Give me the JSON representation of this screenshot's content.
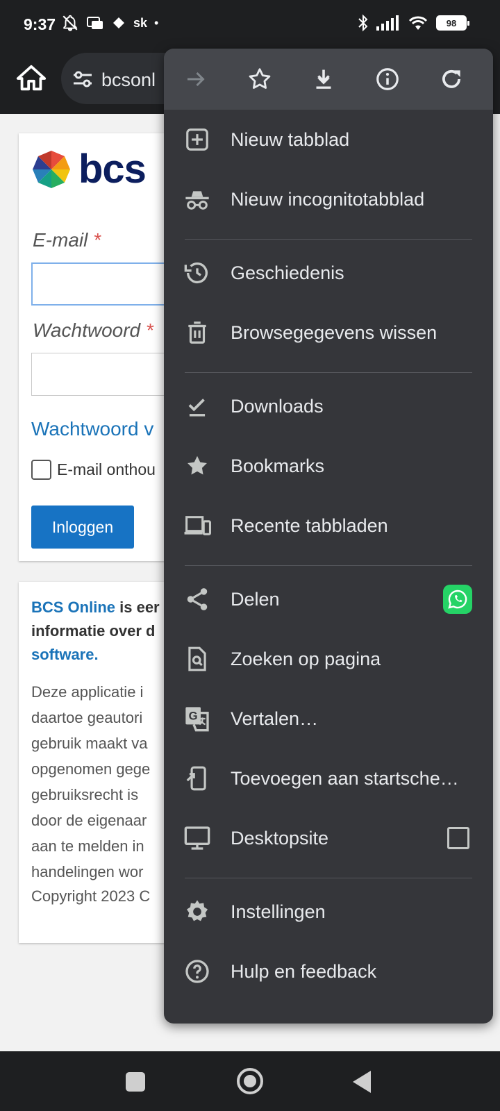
{
  "status": {
    "time": "9:37",
    "sk": "sk",
    "dot": "•",
    "battery": "98"
  },
  "toolbar": {
    "url": "bcsonl"
  },
  "page": {
    "logo_text": "bcs",
    "email_label": "E-mail",
    "password_label": "Wachtwoord",
    "required_mark": "*",
    "forgot_link": "Wachtwoord v",
    "remember_label": "E-mail onthou",
    "login_button": "Inloggen",
    "intro_link": "BCS Online",
    "intro_text": " is eer",
    "intro_line2": "informatie over d",
    "intro_link2": "software.",
    "body_lines": [
      "Deze applicatie i",
      "daartoe geautori",
      "gebruik maakt va",
      "opgenomen gege",
      "gebruiksrecht is",
      "door de eigenaar",
      "aan te melden in",
      "handelingen wor"
    ],
    "copyright": "Copyright 2023 C"
  },
  "menu": {
    "top_icons": [
      "forward-icon",
      "star-icon",
      "download-icon",
      "info-icon",
      "refresh-icon"
    ],
    "items": [
      {
        "label": "Nieuw tabblad",
        "icon": "new-tab-icon"
      },
      {
        "label": "Nieuw incognitotabblad",
        "icon": "incognito-icon"
      },
      {
        "label": "Geschiedenis",
        "icon": "history-icon"
      },
      {
        "label": "Browsegegevens wissen",
        "icon": "trash-icon"
      },
      {
        "label": "Downloads",
        "icon": "downloads-icon"
      },
      {
        "label": "Bookmarks",
        "icon": "bookmarks-icon"
      },
      {
        "label": "Recente tabbladen",
        "icon": "devices-icon"
      },
      {
        "label": "Delen",
        "icon": "share-icon"
      },
      {
        "label": "Zoeken op pagina",
        "icon": "find-in-page-icon"
      },
      {
        "label": "Vertalen…",
        "icon": "translate-icon"
      },
      {
        "label": "Toevoegen aan startsche…",
        "icon": "add-to-home-icon"
      },
      {
        "label": "Desktopsite",
        "icon": "desktop-icon"
      },
      {
        "label": "Instellingen",
        "icon": "settings-icon"
      },
      {
        "label": "Hulp en feedback",
        "icon": "help-icon"
      }
    ]
  },
  "colors": {
    "menu_bg": "#35363a",
    "menu_top": "#45474c",
    "accent_blue": "#1773c4",
    "whatsapp": "#25d366"
  }
}
